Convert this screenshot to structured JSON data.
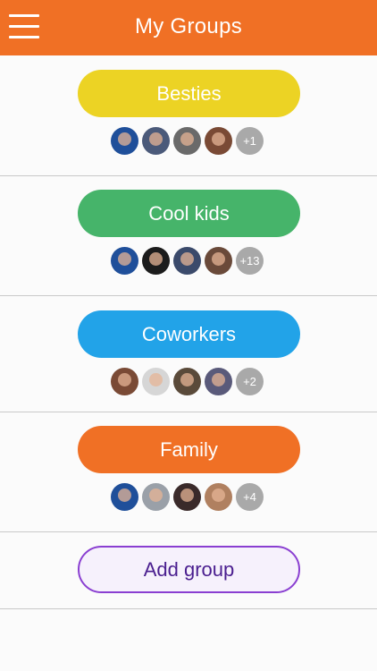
{
  "header": {
    "title": "My Groups",
    "menu_icon": "hamburger-menu-icon"
  },
  "groups": [
    {
      "name": "Besties",
      "color": "#ecd324",
      "more_label": "+1",
      "avatars": [
        "#1f4f9a",
        "#4b5a7a",
        "#6a6a6a",
        "#7a4a35"
      ]
    },
    {
      "name": "Cool kids",
      "color": "#46b46a",
      "more_label": "+13",
      "avatars": [
        "#1f4f9a",
        "#1c1c1c",
        "#3b4a6b",
        "#6a4a3a"
      ]
    },
    {
      "name": "Coworkers",
      "color": "#22a3e8",
      "more_label": "+2",
      "avatars": [
        "#7a4a35",
        "#d6d6d6",
        "#5a4a3a",
        "#5a5a7a"
      ]
    },
    {
      "name": "Family",
      "color": "#f07025",
      "more_label": "+4",
      "avatars": [
        "#1f4f9a",
        "#9aa0a8",
        "#3a2a2a",
        "#b08060"
      ]
    }
  ],
  "add_group": {
    "label": "Add group"
  },
  "colors": {
    "header": "#f07025",
    "add_border": "#8a3fd1",
    "add_text": "#4a1e8f"
  }
}
